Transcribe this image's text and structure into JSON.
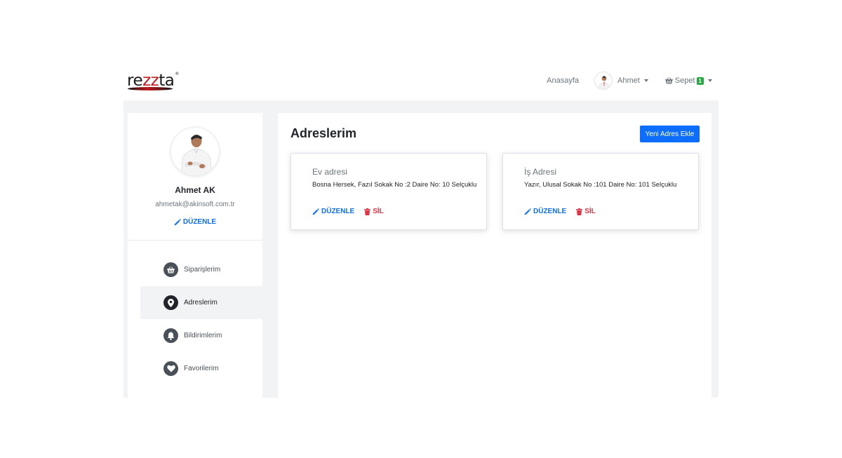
{
  "brand": {
    "logo_a": "re",
    "logo_b": "zz",
    "logo_c": "ta",
    "logo_reg": "®"
  },
  "nav": {
    "home": "Anasayfa",
    "user_name": "Ahmet",
    "cart_label": "Sepet",
    "cart_count": "1"
  },
  "profile": {
    "name": "Ahmet AK",
    "email": "ahmetak@akinsoft.com.tr",
    "edit_label": "DÜZENLE"
  },
  "menu": [
    {
      "label": "Siparişlerim",
      "icon": "basket-icon"
    },
    {
      "label": "Adreslerim",
      "icon": "map-pin-icon",
      "active": true
    },
    {
      "label": "Bildirimlerim",
      "icon": "bell-icon"
    },
    {
      "label": "Favorilerim",
      "icon": "heart-icon"
    }
  ],
  "main": {
    "title": "Adreslerim",
    "add_button": "Yeni Adres Ekle",
    "addresses": [
      {
        "title": "Ev adresi",
        "address": "Bosna Hersek, Fazıl Sokak No :2 Daire No: 10 Selçuklu",
        "edit": "DÜZENLE",
        "delete": "SİL"
      },
      {
        "title": "İş Adresi",
        "address": "Yazır, Ulusal Sokak No :101 Daire No: 101 Selçuklu",
        "edit": "DÜZENLE",
        "delete": "SİL"
      }
    ]
  },
  "colors": {
    "primary": "#0d6efd",
    "danger": "#dc3545",
    "badge": "#28a745",
    "page_bg": "#f1f3f5"
  }
}
